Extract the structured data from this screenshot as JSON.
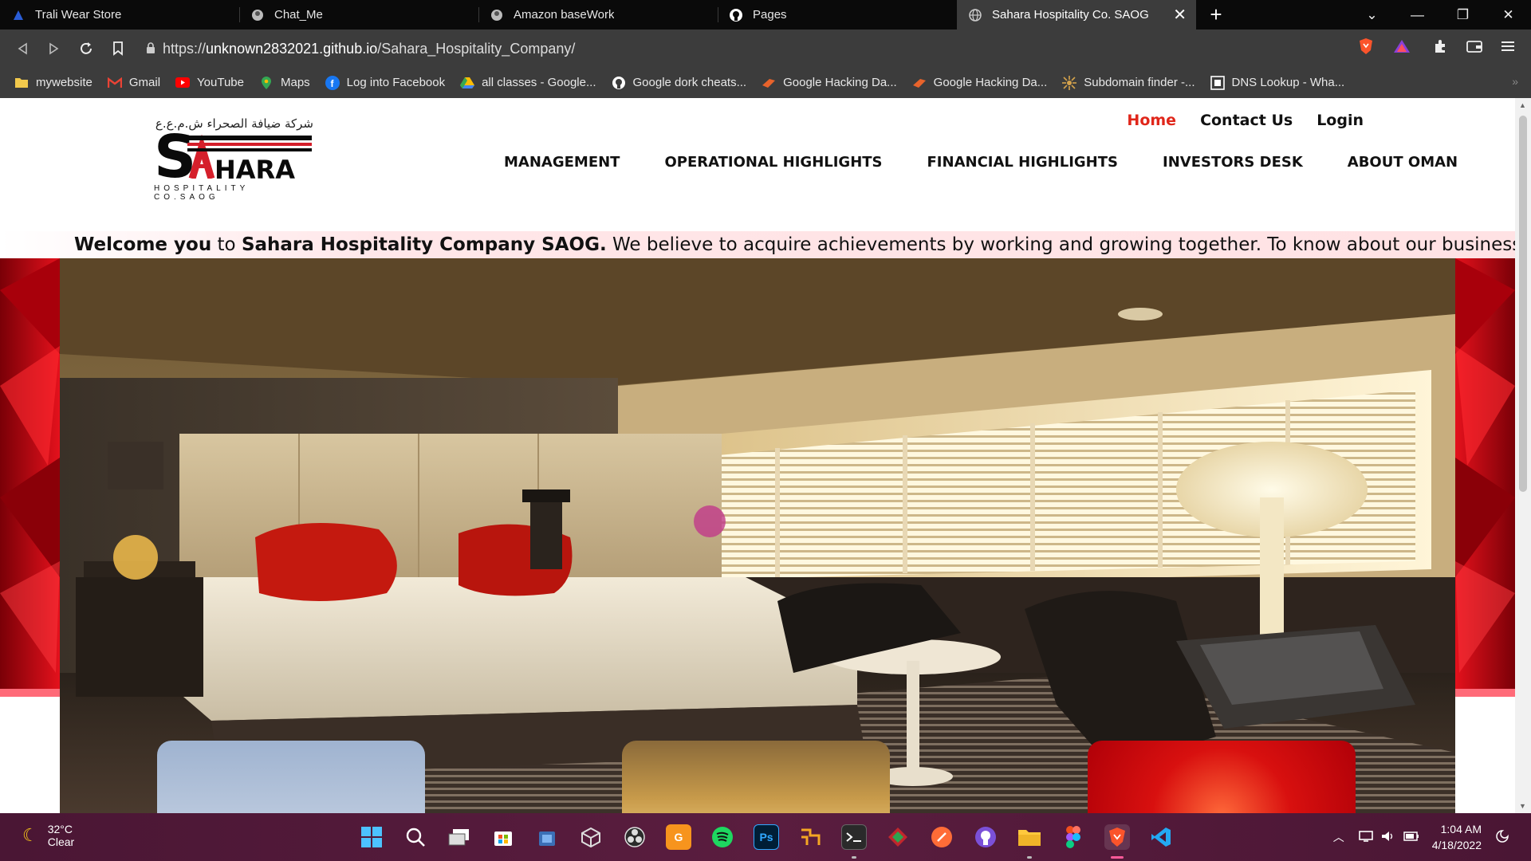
{
  "browser": {
    "tabs": [
      {
        "title": "Trali Wear Store",
        "icon": "trali-favicon",
        "active": false
      },
      {
        "title": "Chat_Me",
        "icon": "chat-favicon",
        "active": false
      },
      {
        "title": "Amazon baseWork",
        "icon": "amazon-favicon",
        "active": false
      },
      {
        "title": "Pages",
        "icon": "github-favicon",
        "active": false
      },
      {
        "title": "Sahara Hospitality Co. SAOG",
        "icon": "globe-favicon",
        "active": true
      }
    ],
    "new_tab_label": "+",
    "url": {
      "scheme": "https://",
      "host": "unknown2832021.github.io",
      "path": "/Sahara_Hospitality_Company/"
    },
    "bookmarks": [
      {
        "label": "mywebsite",
        "icon": "folder-icon",
        "color": "#f2c94c"
      },
      {
        "label": "Gmail",
        "icon": "gmail-icon",
        "color": "#ea4335"
      },
      {
        "label": "YouTube",
        "icon": "youtube-icon",
        "color": "#ff0000"
      },
      {
        "label": "Maps",
        "icon": "maps-icon",
        "color": "#34a853"
      },
      {
        "label": "Log into Facebook",
        "icon": "facebook-icon",
        "color": "#1877f2"
      },
      {
        "label": "all classes - Google...",
        "icon": "drive-icon",
        "color": "#fbbc04"
      },
      {
        "label": "Google dork cheats...",
        "icon": "github-icon",
        "color": "#ffffff"
      },
      {
        "label": "Google Hacking Da...",
        "icon": "exploit-db-icon",
        "color": "#e8632b"
      },
      {
        "label": "Google Hacking Da...",
        "icon": "exploit-db-icon",
        "color": "#e8632b"
      },
      {
        "label": "Subdomain finder -...",
        "icon": "subdomain-icon",
        "color": "#d4a24c"
      },
      {
        "label": "DNS Lookup - Wha...",
        "icon": "dns-icon",
        "color": "#ffffff"
      }
    ]
  },
  "site": {
    "logo_arabic": "شركة ضيافة الصحراء ش.م.ع.ع",
    "logo_sub": "HOSPITALITY CO.SAOG",
    "top_links": {
      "home": "Home",
      "contact": "Contact Us",
      "login": "Login"
    },
    "nav": {
      "management": "MANAGEMENT",
      "operational": "OPERATIONAL HIGHLIGHTS",
      "financial": "FINANCIAL HIGHLIGHTS",
      "investors": "INVESTORS DESK",
      "oman": "ABOUT OMAN"
    },
    "marquee": {
      "part1": "Welcome you",
      "part2": " to ",
      "part3": "Sahara Hospitality Company SAOG.",
      "part4": " We believe to acquire achievements by working and growing together. To know about our business growth"
    },
    "accent_color": "#e0261a"
  },
  "taskbar": {
    "weather_temp": "32°C",
    "weather_desc": "Clear",
    "time": "1:04 AM",
    "date": "4/18/2022",
    "apps": [
      "start-icon",
      "search-icon",
      "task-view-icon",
      "store-icon",
      "store-bag-icon",
      "box-icon",
      "obs-icon",
      "pdf-icon",
      "spotify-icon",
      "photoshop-icon",
      "git-tool-icon",
      "terminal-icon",
      "diamond-app-icon",
      "postman-icon",
      "github-desktop-icon",
      "file-explorer-icon",
      "figma-icon",
      "brave-icon",
      "vscode-icon"
    ]
  }
}
